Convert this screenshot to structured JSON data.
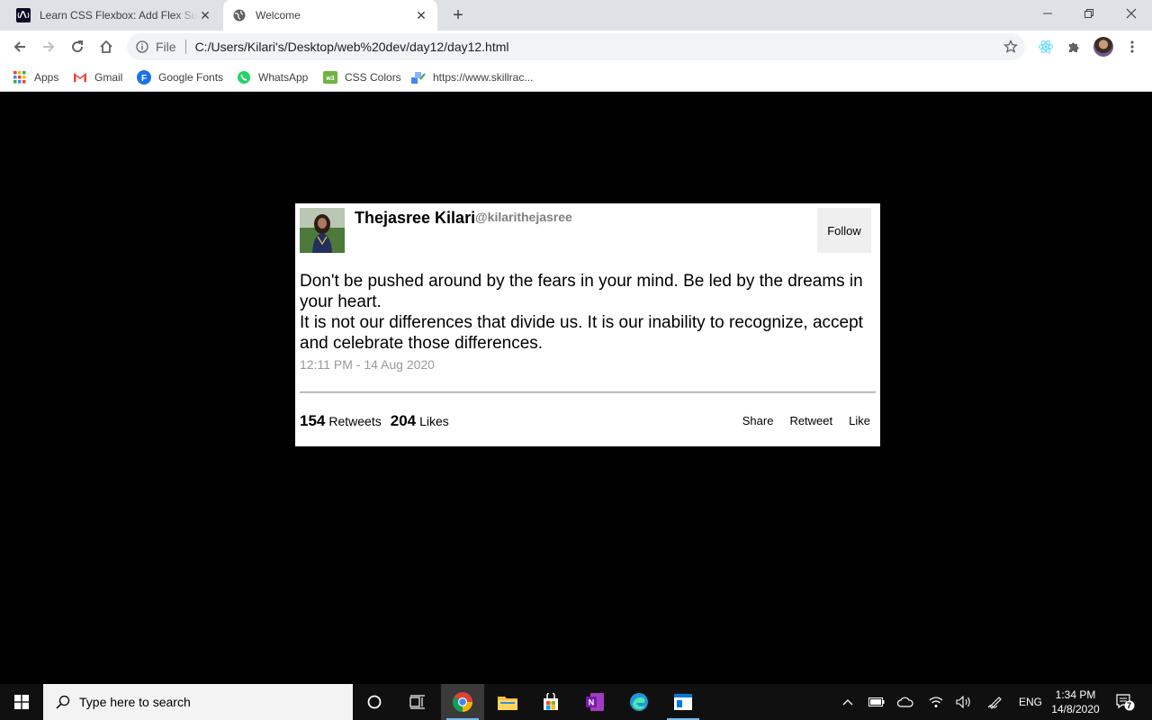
{
  "browser": {
    "tabs": [
      {
        "title": "Learn CSS Flexbox: Add Flex Superpowers",
        "active": false
      },
      {
        "title": "Welcome",
        "active": true
      }
    ],
    "address": {
      "scheme_label": "File",
      "url": "C:/Users/Kilari's/Desktop/web%20dev/day12/day12.html"
    },
    "bookmarks": [
      {
        "label": "Apps",
        "icon": "apps-grid-icon"
      },
      {
        "label": "Gmail",
        "icon": "gmail-icon"
      },
      {
        "label": "Google Fonts",
        "icon": "google-fonts-icon"
      },
      {
        "label": "WhatsApp",
        "icon": "whatsapp-icon"
      },
      {
        "label": "CSS Colors",
        "icon": "css-colors-icon"
      },
      {
        "label": "https://www.skillrac...",
        "icon": "skillrack-icon"
      }
    ]
  },
  "tweet": {
    "name": "Thejasree Kilari",
    "handle": "@kilarithejasree",
    "follow_label": "Follow",
    "text_line1": "Don't be pushed around by the fears in your mind. Be led by the dreams in your heart.",
    "text_line2": "It is not our differences that divide us. It is our inability to recognize, accept and celebrate those differences.",
    "timestamp": "12:11 PM - 14 Aug 2020",
    "retweets_count": "154",
    "retweets_label": "Retweets",
    "likes_count": "204",
    "likes_label": "Likes",
    "actions": {
      "share": "Share",
      "retweet": "Retweet",
      "like": "Like"
    }
  },
  "taskbar": {
    "search_placeholder": "Type here to search",
    "language": "ENG",
    "time": "1:34 PM",
    "date": "14/8/2020",
    "notifications_count": "7"
  }
}
